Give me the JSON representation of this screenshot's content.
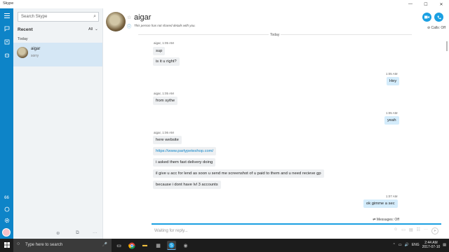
{
  "window": {
    "title": "Skype",
    "min": "—",
    "max": "☐",
    "close": "✕"
  },
  "rail": {
    "icons": [
      "menu-icon",
      "chat-icon",
      "contacts-icon",
      "bot-icon",
      "dialpad-icon",
      "help-icon",
      "settings-icon"
    ],
    "credit_label": "66"
  },
  "sidebar": {
    "search_placeholder": "Search Skype",
    "recent_label": "Recent",
    "filter_label": "All",
    "section_today": "Today",
    "conversations": [
      {
        "name": "aigar",
        "status": "sorry"
      }
    ]
  },
  "header": {
    "name": "aigar",
    "subtitle": "This person has not shared details with you.",
    "calls_status": "Calls: Off"
  },
  "chat": {
    "day_separator": "Today",
    "messages": [
      {
        "dir": "in",
        "meta": "aigar, 1:05 AM",
        "text": "sup"
      },
      {
        "dir": "in",
        "text": "is it u right?"
      },
      {
        "dir": "out",
        "meta": "1:05 AM",
        "text": "Hey"
      },
      {
        "dir": "in",
        "meta": "aigar, 1:05 AM",
        "text": "from sythe"
      },
      {
        "dir": "out",
        "meta": "1:05 AM",
        "text": "yeah"
      },
      {
        "dir": "in",
        "meta": "aigar, 1:06 AM",
        "text": "here website"
      },
      {
        "dir": "in",
        "text": "https://www.partypeteshop.com/",
        "link": true
      },
      {
        "dir": "in",
        "text": "i asked them fast delivery doing"
      },
      {
        "dir": "in",
        "text": "il give u acc for lend as soon u send me screenshot of u paid to them and u need recieve gp"
      },
      {
        "dir": "in",
        "text": "because i dont have lvl 3 accounts"
      },
      {
        "dir": "out",
        "meta": "1:07 AM",
        "text": "ok gimme a sec"
      }
    ],
    "messages_status": "Messages: Off"
  },
  "composer": {
    "placeholder": "Waiting for reply..."
  },
  "taskbar": {
    "search_placeholder": "Type here to search",
    "tray_lang": "ENG",
    "time": "2:44 AM",
    "date": "2017-07-10"
  }
}
